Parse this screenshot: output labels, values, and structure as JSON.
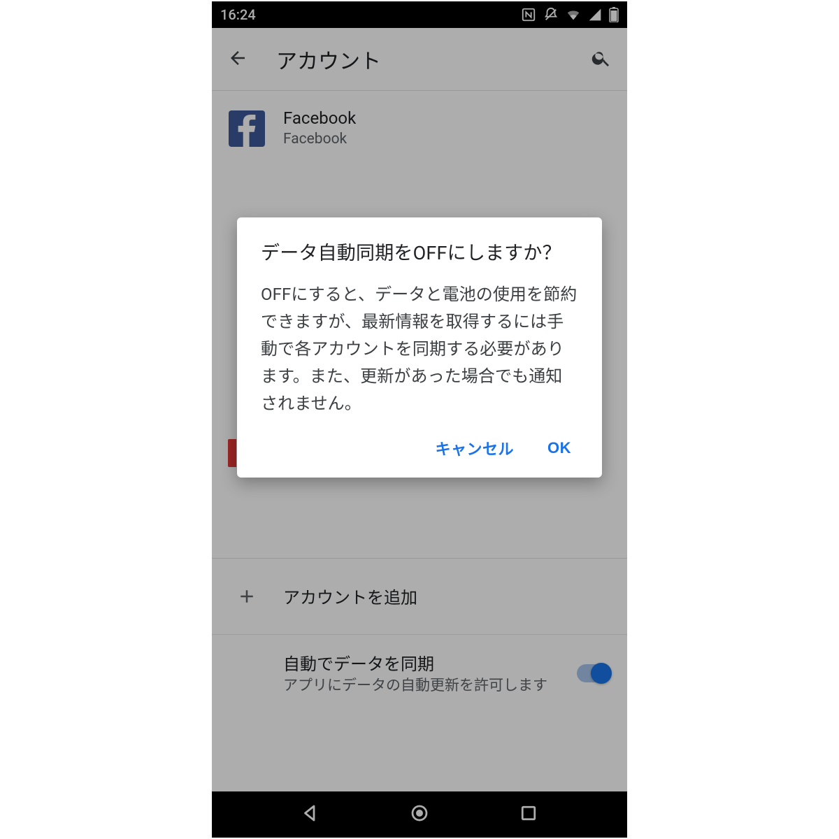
{
  "status": {
    "time": "16:24"
  },
  "appbar": {
    "title": "アカウント"
  },
  "accounts": {
    "facebook": {
      "name": "Facebook",
      "provider": "Facebook"
    }
  },
  "add_account": {
    "label": "アカウントを追加"
  },
  "auto_sync": {
    "title": "自動でデータを同期",
    "subtitle": "アプリにデータの自動更新を許可します"
  },
  "dialog": {
    "title": "データ自動同期をOFFにしますか？",
    "body": "OFFにすると、データと電池の使用を節約できますが、最新情報を取得するには手動で各アカウントを同期する必要があります。また、更新があった場合でも通知されません。",
    "cancel": "キャンセル",
    "ok": "OK"
  }
}
